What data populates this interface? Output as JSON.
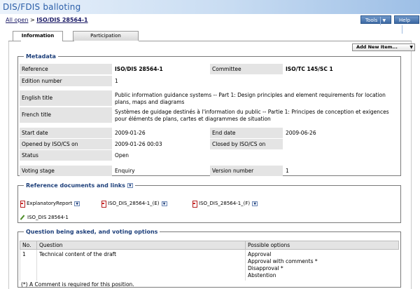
{
  "app": {
    "title": "DIS/FDIS balloting"
  },
  "breadcrumb": {
    "root": "All open",
    "separator": ">",
    "current": "ISO/DIS 28564-1"
  },
  "toolbar": {
    "tools_label": "Tools",
    "help_label": "Help"
  },
  "tabs": [
    {
      "label": "Information",
      "active": true
    },
    {
      "label": "Participation",
      "active": false
    }
  ],
  "add_new": {
    "label": "Add New Item..."
  },
  "metadata": {
    "title": "Metadata",
    "reference": {
      "label": "Reference",
      "value": "ISO/DIS 28564-1"
    },
    "committee": {
      "label": "Committee",
      "value": "ISO/TC 145/SC 1"
    },
    "edition": {
      "label": "Edition number",
      "value": "1"
    },
    "english_title": {
      "label": "English title",
      "value": "Public information guidance systems -- Part 1: Design principles and element requirements for location plans, maps and diagrams"
    },
    "french_title": {
      "label": "French title",
      "value": "Systèmes de guidage destinés à l'information du public -- Partie 1: Principes de conception et exigences pour éléments de plans, cartes et diagrammes de situation"
    },
    "start_date": {
      "label": "Start date",
      "value": "2009-01-26"
    },
    "end_date": {
      "label": "End date",
      "value": "2009-06-26"
    },
    "opened_by": {
      "label": "Opened by ISO/CS on",
      "value": "2009-01-26 00:03"
    },
    "closed_by": {
      "label": "Closed by ISO/CS on",
      "value": ""
    },
    "status": {
      "label": "Status",
      "value": "Open"
    },
    "voting_stage": {
      "label": "Voting stage",
      "value": "Enquiry"
    },
    "version_number": {
      "label": "Version number",
      "value": "1"
    }
  },
  "references": {
    "title": "Reference documents and links",
    "docs": [
      {
        "name": "ExplanatoryReport",
        "icon": "pdf-icon"
      },
      {
        "name": "ISO_DIS_28564-1_(E)",
        "icon": "pdf-icon"
      },
      {
        "name": "ISO_DIS_28564-1_(F)",
        "icon": "pdf-icon"
      }
    ],
    "link": {
      "name": "ISO_DIS 28564-1",
      "icon": "pen-icon"
    }
  },
  "question": {
    "title": "Question being asked, and voting options",
    "headers": {
      "no": "No.",
      "question": "Question",
      "options": "Possible options"
    },
    "rows": [
      {
        "no": "1",
        "question": "Technical content of the draft",
        "options": [
          "Approval",
          "Approval with comments  *",
          "Disapproval  *",
          "Abstention"
        ]
      }
    ],
    "note": "(*) A Comment is required for this position."
  }
}
